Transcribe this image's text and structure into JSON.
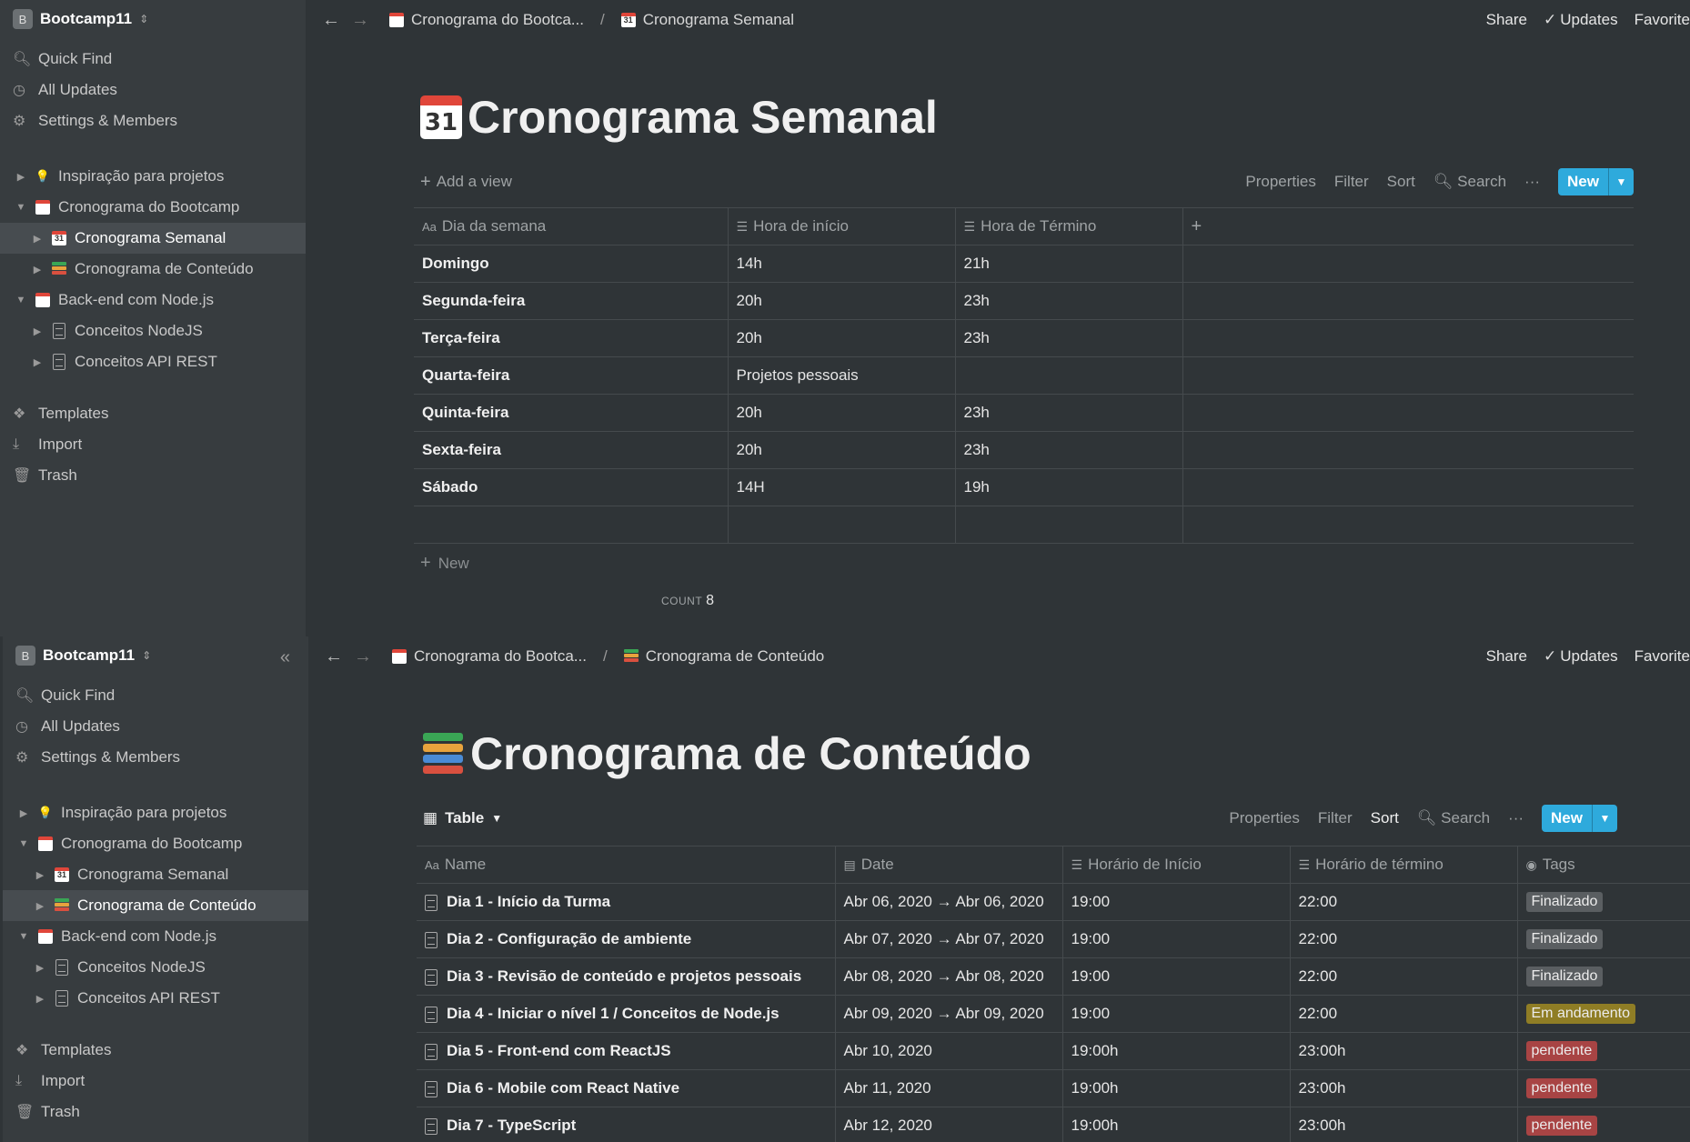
{
  "workspace": {
    "name": "Bootcamp11",
    "badge": "B"
  },
  "sidebar": {
    "menu": [
      {
        "label": "Quick Find",
        "icon": "search-icon"
      },
      {
        "label": "All Updates",
        "icon": "clock-icon"
      },
      {
        "label": "Settings & Members",
        "icon": "gear-icon"
      }
    ],
    "tree": [
      {
        "label": "Inspiração para projetos",
        "icon": "bulb-icon"
      },
      {
        "label": "Cronograma do Bootcamp",
        "icon": "calendar-icon"
      },
      {
        "label": "Cronograma Semanal",
        "icon": "calendar-31-icon"
      },
      {
        "label": "Cronograma de Conteúdo",
        "icon": "books-icon"
      },
      {
        "label": "Back-end com Node.js",
        "icon": "calendar-icon"
      },
      {
        "label": "Conceitos NodeJS",
        "icon": "page-icon"
      },
      {
        "label": "Conceitos API REST",
        "icon": "page-icon"
      }
    ],
    "bottom": [
      {
        "label": "Templates",
        "icon": "templates-icon"
      },
      {
        "label": "Import",
        "icon": "import-icon"
      },
      {
        "label": "Trash",
        "icon": "trash-icon"
      }
    ]
  },
  "topbar": {
    "share": "Share",
    "updates": "Updates",
    "favorite": "Favorite",
    "separator": "/"
  },
  "view_toolbar": {
    "add_view": "Add a view",
    "table": "Table",
    "properties": "Properties",
    "filter": "Filter",
    "sort": "Sort",
    "search": "Search",
    "more": "···",
    "new": "New"
  },
  "semanal": {
    "breadcrumb": [
      "Cronograma do Bootca...",
      "Cronograma Semanal"
    ],
    "title": "Cronograma Semanal",
    "columns": [
      "Dia da semana",
      "Hora de início",
      "Hora de Término"
    ],
    "rows": [
      [
        "Domingo",
        "14h",
        "21h"
      ],
      [
        "Segunda-feira",
        "20h",
        "23h"
      ],
      [
        "Terça-feira",
        "20h",
        "23h"
      ],
      [
        "Quarta-feira",
        "Projetos pessoais",
        ""
      ],
      [
        "Quinta-feira",
        "20h",
        "23h"
      ],
      [
        "Sexta-feira",
        "20h",
        "23h"
      ],
      [
        "Sábado",
        "14H",
        "19h"
      ]
    ],
    "new_row": "New",
    "count_label": "COUNT",
    "count_value": "8"
  },
  "conteudo": {
    "breadcrumb": [
      "Cronograma do Bootca...",
      "Cronograma de Conteúdo"
    ],
    "title": "Cronograma de Conteúdo",
    "columns": [
      "Name",
      "Date",
      "Horário de Início",
      "Horário de término",
      "Tags"
    ],
    "rows": [
      [
        "Dia 1 - Início da Turma",
        "Abr 06, 2020 → Abr 06, 2020",
        "19:00",
        "22:00",
        "Finalizado"
      ],
      [
        "Dia 2 - Configuração de ambiente",
        "Abr 07, 2020 → Abr 07, 2020",
        "19:00",
        "22:00",
        "Finalizado"
      ],
      [
        "Dia 3 - Revisão de conteúdo e projetos pessoais",
        "Abr 08, 2020 → Abr 08, 2020",
        "19:00",
        "22:00",
        "Finalizado"
      ],
      [
        "Dia 4 - Iniciar o nível 1 / Conceitos de Node.js",
        "Abr 09, 2020 → Abr 09, 2020",
        "19:00",
        "22:00",
        "Em andamento"
      ],
      [
        "Dia 5 - Front-end com ReactJS",
        "Abr 10, 2020",
        "19:00h",
        "23:00h",
        "pendente"
      ],
      [
        "Dia 6 - Mobile com React Native",
        "Abr 11, 2020",
        "19:00h",
        "23:00h",
        "pendente"
      ],
      [
        "Dia 7 - TypeScript",
        "Abr 12, 2020",
        "19:00h",
        "23:00h",
        "pendente"
      ]
    ],
    "tag_colors": {
      "Finalizado": "#5a5e61",
      "Em andamento": "#8f7d25",
      "pendente": "#a84444"
    }
  },
  "colors": {
    "background": "#2f3437",
    "sidebar": "#373c3f",
    "accent": "#2eaadc"
  }
}
